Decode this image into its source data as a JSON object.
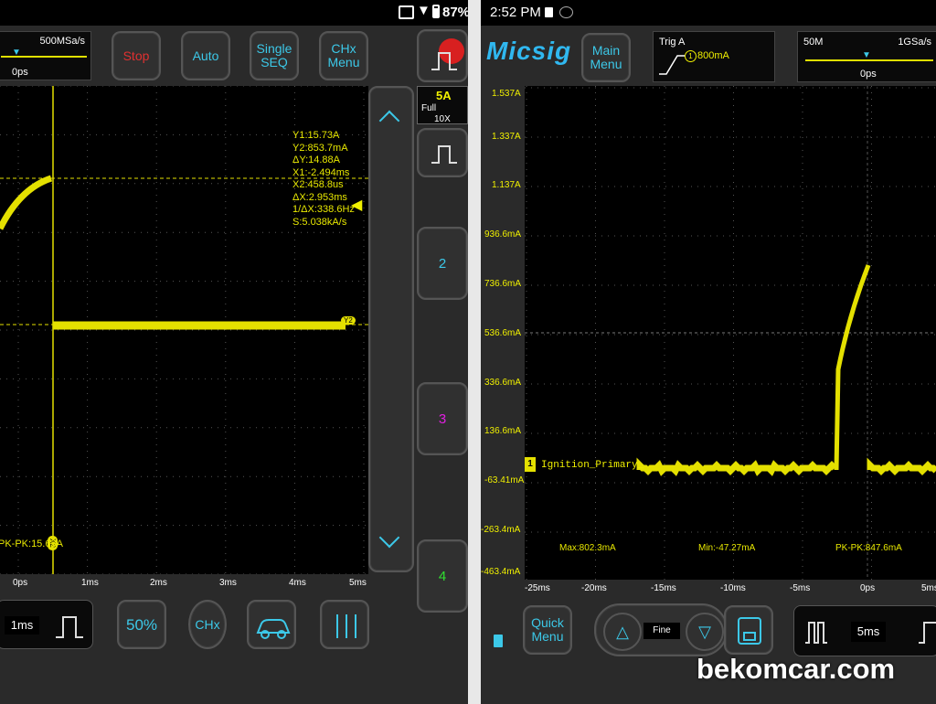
{
  "left": {
    "status": {
      "battery": "87%"
    },
    "sample_rate": "500MSa/s",
    "trigger_pos": "0ps",
    "buttons": {
      "stop": "Stop",
      "auto": "Auto",
      "single": "Single\nSEQ",
      "chx_menu": "CHx\nMenu",
      "fifty": "50%",
      "chx": "CHx",
      "timebase": "1ms"
    },
    "channel_box": {
      "scale": "5A",
      "bw": "Full",
      "probe": "10X"
    },
    "channels": [
      "2",
      "3",
      "4"
    ],
    "cursor_readout": [
      "Y1:15.73A",
      "Y2:853.7mA",
      "ΔY:14.88A",
      "X1:-2.494ms",
      "X2:458.8us",
      "ΔX:2.953ms",
      "1/ΔX:338.6Hz",
      "S:5.038kA/s"
    ],
    "pk_pk": "PK-PK:15.63A",
    "marker_y2": "Y2",
    "marker_x2": "X2",
    "x_ticks": [
      "0ps",
      "1ms",
      "2ms",
      "3ms",
      "4ms",
      "5ms"
    ]
  },
  "right": {
    "status": {
      "time": "2:52 PM"
    },
    "logo": "Micsig",
    "buttons": {
      "main_menu": "Main\nMenu",
      "quick_menu": "Quick\nMenu",
      "fine": "Fine",
      "timebase": "5ms"
    },
    "trigger": {
      "label": "Trig A",
      "level": "800mA",
      "channel": "1"
    },
    "memory": "50M",
    "sample_rate": "1GSa/s",
    "trigger_pos": "0ps",
    "y_ticks": [
      "1.537A",
      "1.337A",
      "1.137A",
      "936.6mA",
      "736.6mA",
      "536.6mA",
      "336.6mA",
      "136.6mA",
      "-63.41mA",
      "-263.4mA",
      "-463.4mA"
    ],
    "x_ticks": [
      "-25ms",
      "-20ms",
      "-15ms",
      "-10ms",
      "-5ms",
      "0ps",
      "5ms"
    ],
    "channel_label": "Ignition_Primary_",
    "channel_num": "1",
    "measurements": {
      "max": "Max:802.3mA",
      "min": "Min:-47.27mA",
      "pkpk": "PK-PK:847.6mA"
    }
  },
  "watermark": "bekomcar.com",
  "colors": {
    "trace": "#e4e000",
    "accent": "#3cc8e8",
    "stop": "#e03030",
    "ch2": "#3cc8e8",
    "ch3": "#e020e0",
    "ch4": "#30e030"
  }
}
